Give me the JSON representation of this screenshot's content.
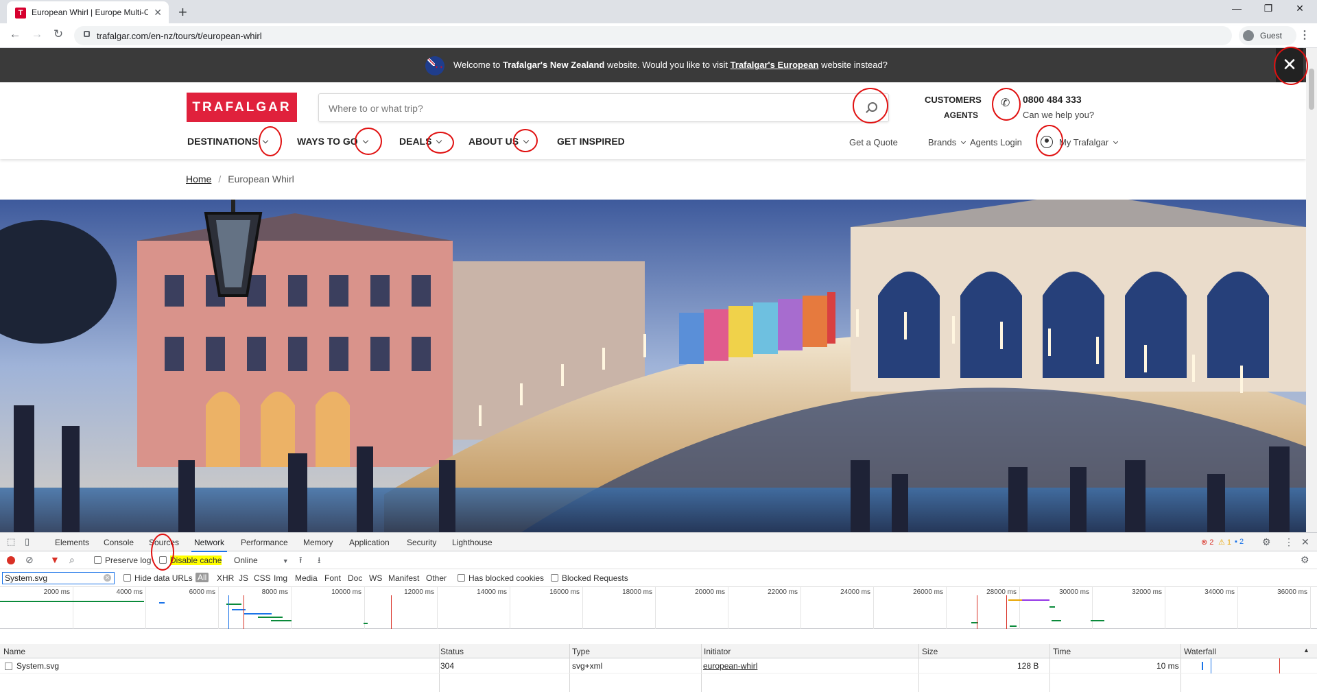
{
  "browser": {
    "tab_title": "European Whirl | Europe Multi-Co",
    "url": "trafalgar.com/en-nz/tours/t/european-whirl",
    "profile": "Guest"
  },
  "banner": {
    "prefix": "Welcome to ",
    "site_bold": "Trafalgar's New Zealand",
    "middle": " website. Would you like to visit ",
    "link": "Trafalgar's European",
    "suffix": " website instead?"
  },
  "header": {
    "logo": "TRAFALGAR",
    "search_placeholder": "Where to or what trip?",
    "customers": "CUSTOMERS",
    "agents": "AGENTS",
    "phone": "0800 484 333",
    "help": "Can we help you?"
  },
  "nav": {
    "main": [
      "DESTINATIONS",
      "WAYS TO GO",
      "DEALS",
      "ABOUT US",
      "GET INSPIRED"
    ],
    "secondary": [
      "Get a Quote",
      "Brands",
      "Agents Login",
      "My Trafalgar"
    ]
  },
  "breadcrumb": {
    "home": "Home",
    "current": "European Whirl"
  },
  "devtools": {
    "tabs": [
      "Elements",
      "Console",
      "Sources",
      "Network",
      "Performance",
      "Memory",
      "Application",
      "Security",
      "Lighthouse"
    ],
    "active_tab": "Network",
    "errors": "2",
    "warnings": "1",
    "messages": "2",
    "preserve_log": "Preserve log",
    "disable_cache": "Disable cache",
    "throttle": "Online",
    "filter_value": "System.svg",
    "hide_data_urls": "Hide data URLs",
    "types": [
      "All",
      "XHR",
      "JS",
      "CSS",
      "Img",
      "Media",
      "Font",
      "Doc",
      "WS",
      "Manifest",
      "Other"
    ],
    "has_blocked_cookies": "Has blocked cookies",
    "blocked_requests": "Blocked Requests",
    "timeline_ticks": [
      "2000 ms",
      "4000 ms",
      "6000 ms",
      "8000 ms",
      "10000 ms",
      "12000 ms",
      "14000 ms",
      "16000 ms",
      "18000 ms",
      "20000 ms",
      "22000 ms",
      "24000 ms",
      "26000 ms",
      "28000 ms",
      "30000 ms",
      "32000 ms",
      "34000 ms",
      "36000 ms"
    ],
    "columns": [
      "Name",
      "Status",
      "Type",
      "Initiator",
      "Size",
      "Time",
      "Waterfall"
    ],
    "rows": [
      {
        "name": "System.svg",
        "status": "304",
        "type": "svg+xml",
        "initiator": "european-whirl",
        "size": "128 B",
        "time": "10 ms"
      }
    ]
  },
  "colors": {
    "brand": "#e0213c",
    "banner_bg": "#3a3a3a",
    "annotation": "#e01010",
    "highlight": "#ffff00",
    "devtools_accent": "#1a73e8"
  }
}
